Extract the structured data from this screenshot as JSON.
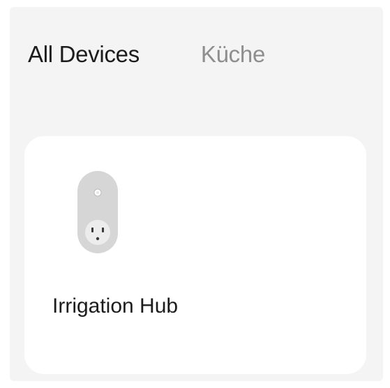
{
  "tabs": {
    "all_devices": "All Devices",
    "kitchen": "Küche"
  },
  "devices": [
    {
      "name": "Irrigation Hub",
      "icon": "smart-plug-icon"
    }
  ],
  "colors": {
    "background": "#f4f4f4",
    "card": "#ffffff",
    "active_tab_text": "#1c1c1c",
    "inactive_tab_text": "#8e8e8e",
    "plug_body": "#d6d6d6"
  }
}
